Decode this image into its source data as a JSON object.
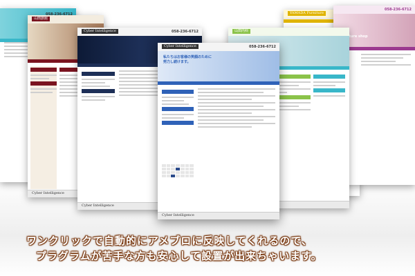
{
  "phone_number": "058-236-6712",
  "brand_logo": "Cyber Intelligence",
  "hero_copy_line1": "私たちはお客様の笑顔のために",
  "hero_copy_line2": "努力し続けます。",
  "card_tab_labels": {
    "jingoya": "山田旅館",
    "yamada_furniture": "YAMADA Furniture",
    "yamada_naika": "山田内科",
    "furniture_shop": "Furniture shop"
  },
  "caption": {
    "line1": "ワンクリックで自動的にアメブロに反映してくれるので、",
    "line2": "プラグラムが苦手な方も安心して設置が出来ちゃいます。"
  },
  "colors": {
    "teal": "#39b7c9",
    "wine": "#7a1420",
    "navy": "#1d2f57",
    "blue": "#2f62b8",
    "green": "#8bc34a",
    "gold": "#e0b400",
    "purple": "#9b3a8f",
    "caption_outline": "#7a3a12"
  }
}
